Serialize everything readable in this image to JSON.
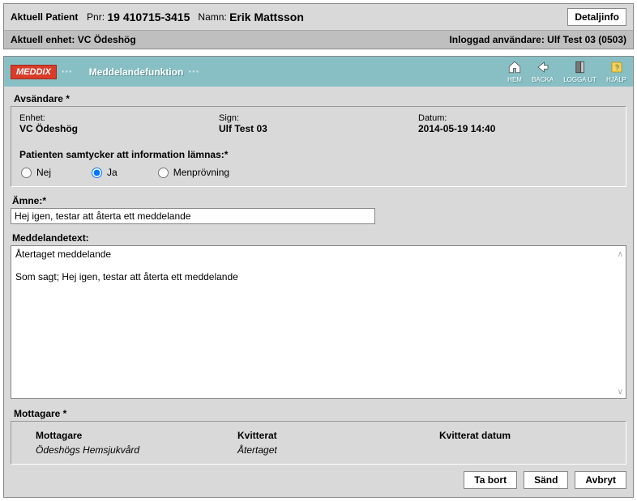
{
  "patient_bar": {
    "title": "Aktuell Patient",
    "pnr_label": "Pnr:",
    "pnr": "19 410715-3415",
    "name_label": "Namn:",
    "name": "Erik Mattsson",
    "detail_btn": "Detaljinfo"
  },
  "enhet_bar": {
    "label": "Aktuell enhet:",
    "value": "VC Ödeshög",
    "user_label": "Inloggad användare:",
    "user": "Ulf Test 03 (0503)"
  },
  "titlebar": {
    "logo": "MEDDIX",
    "title": "Meddelandefunktion",
    "tools": {
      "home": "HEM",
      "back": "BACKA",
      "logout": "LOGGA UT",
      "help": "HJÄLP"
    }
  },
  "sender": {
    "section": "Avsändare *",
    "enhet_label": "Enhet:",
    "enhet": "VC Ödeshög",
    "sign_label": "Sign:",
    "sign": "Ulf Test 03",
    "date_label": "Datum:",
    "date": "2014-05-19 14:40"
  },
  "consent": {
    "label": "Patienten samtycker att information lämnas:*",
    "opt_no": "Nej",
    "opt_yes": "Ja",
    "opt_men": "Menprövning",
    "selected": "Ja"
  },
  "subject": {
    "label": "Ämne:*",
    "value": "Hej igen, testar att återta ett meddelande"
  },
  "body": {
    "label": "Meddelandetext:",
    "value": "Återtaget meddelande\n\nSom sagt; Hej igen, testar att återta ett meddelande"
  },
  "recipients": {
    "section": "Mottagare *",
    "th_name": "Mottagare",
    "th_ack": "Kvitterat",
    "th_ackdate": "Kvitterat datum",
    "rows": [
      {
        "name": "Ödeshögs Hemsjukvård",
        "ack": "Återtaget",
        "ackdate": ""
      }
    ]
  },
  "buttons": {
    "delete": "Ta bort",
    "send": "Sänd",
    "cancel": "Avbryt"
  }
}
